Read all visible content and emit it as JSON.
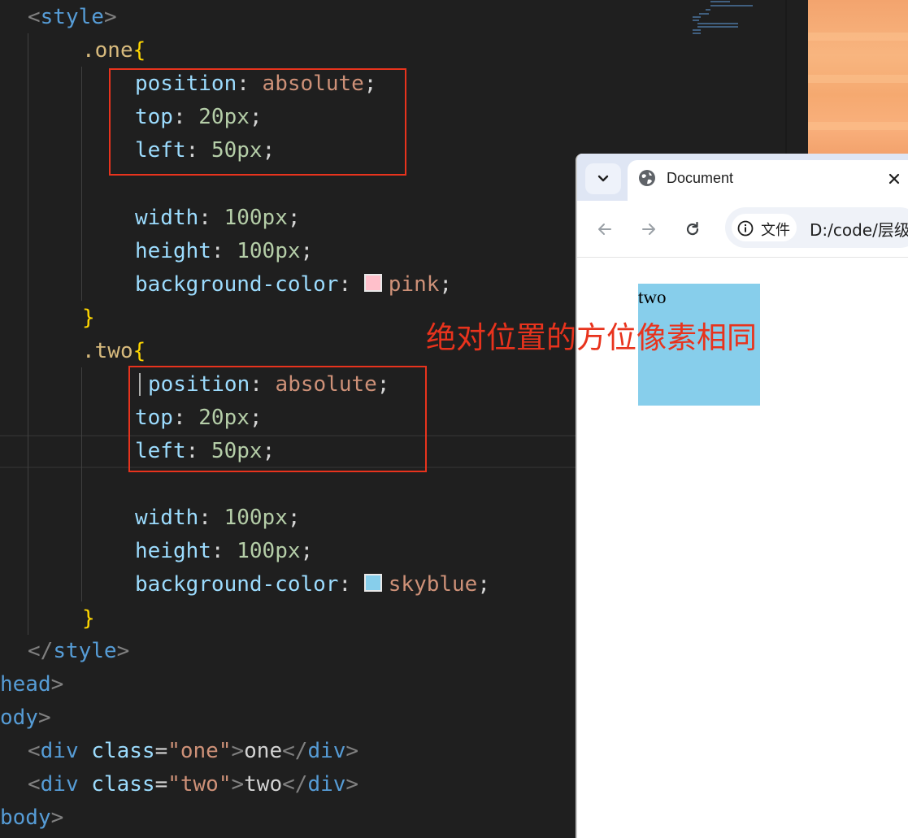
{
  "editor": {
    "lines": {
      "l1": {
        "open": "<",
        "tag": "style",
        "close": ">"
      },
      "l2": {
        "selector": ".one",
        "brace": "{"
      },
      "l3": {
        "prop": "position",
        "colon": ": ",
        "value": "absolute",
        "semi": ";"
      },
      "l4": {
        "prop": "top",
        "colon": ": ",
        "value": "20px",
        "semi": ";"
      },
      "l5": {
        "prop": "left",
        "colon": ": ",
        "value": "50px",
        "semi": ";"
      },
      "l6": {
        "prop": "width",
        "colon": ": ",
        "value": "100px",
        "semi": ";"
      },
      "l7": {
        "prop": "height",
        "colon": ": ",
        "value": "100px",
        "semi": ";"
      },
      "l8": {
        "prop": "background-color",
        "colon": ": ",
        "value": "pink",
        "semi": ";"
      },
      "l9": {
        "brace": "}"
      },
      "l10": {
        "selector": ".two",
        "brace": "{"
      },
      "l11": {
        "prop": "position",
        "colon": ": ",
        "value": "absolute",
        "semi": ";"
      },
      "l12": {
        "prop": "top",
        "colon": ": ",
        "value": "20px",
        "semi": ";"
      },
      "l13": {
        "prop": "left",
        "colon": ": ",
        "value": "50px",
        "semi": ";"
      },
      "l14": {
        "prop": "width",
        "colon": ": ",
        "value": "100px",
        "semi": ";"
      },
      "l15": {
        "prop": "height",
        "colon": ": ",
        "value": "100px",
        "semi": ";"
      },
      "l16": {
        "prop": "background-color",
        "colon": ": ",
        "value": "skyblue",
        "semi": ";"
      },
      "l17": {
        "brace": "}"
      },
      "l18": {
        "open": "</",
        "tag": "style",
        "close": ">"
      },
      "l19": {
        "tag": "head",
        "close": ">"
      },
      "l20": {
        "tag": "ody",
        "close": ">"
      },
      "l21": {
        "open": "<",
        "tag": "div",
        "attr": "class",
        "eq": "=",
        "val": "\"one\"",
        "gt": ">",
        "text": "one",
        "endopen": "</",
        "endtag": "div",
        "endclose": ">"
      },
      "l22": {
        "open": "<",
        "tag": "div",
        "attr": "class",
        "eq": "=",
        "val": "\"two\"",
        "gt": ">",
        "text": "two",
        "endopen": "</",
        "endtag": "div",
        "endclose": ">"
      },
      "l23": {
        "tag": "body",
        "close": ">"
      }
    },
    "annotation": "绝对位置的方位像素相同",
    "colors": {
      "highlight": "#e8331d",
      "pink": "#ffc0cb",
      "skyblue": "#87ceeb"
    }
  },
  "browser": {
    "tab_title": "Document",
    "site_chip_label": "文件",
    "url": "D:/code/层级",
    "icons": {
      "tab_search": "chevron-down-icon",
      "favicon": "globe-icon",
      "close": "close-icon",
      "back": "arrow-left-icon",
      "forward": "arrow-right-icon",
      "reload": "reload-icon",
      "info": "info-icon"
    },
    "page": {
      "box_label": "two",
      "box_color": "#87ceeb"
    }
  }
}
